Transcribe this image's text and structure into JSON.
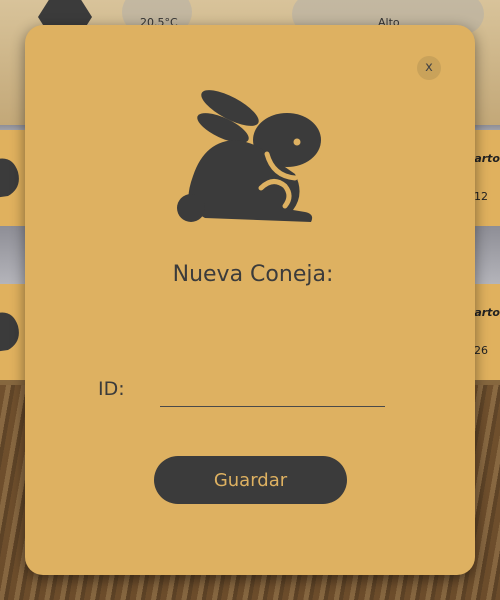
{
  "background": {
    "header_values": [
      "20.5°C",
      "Alto"
    ],
    "cards": [
      {
        "label": "Parto",
        "number": "12"
      },
      {
        "label": "Parto",
        "number": "26"
      }
    ]
  },
  "modal": {
    "close_label": "x",
    "icon": "rabbit-icon",
    "title": "Nueva Coneja:",
    "id_label": "ID:",
    "id_value": "",
    "id_placeholder": "",
    "save_label": "Guardar"
  },
  "colors": {
    "modal_bg": "#deb161",
    "dark": "#3b3b3b",
    "button_text": "#deb161"
  }
}
